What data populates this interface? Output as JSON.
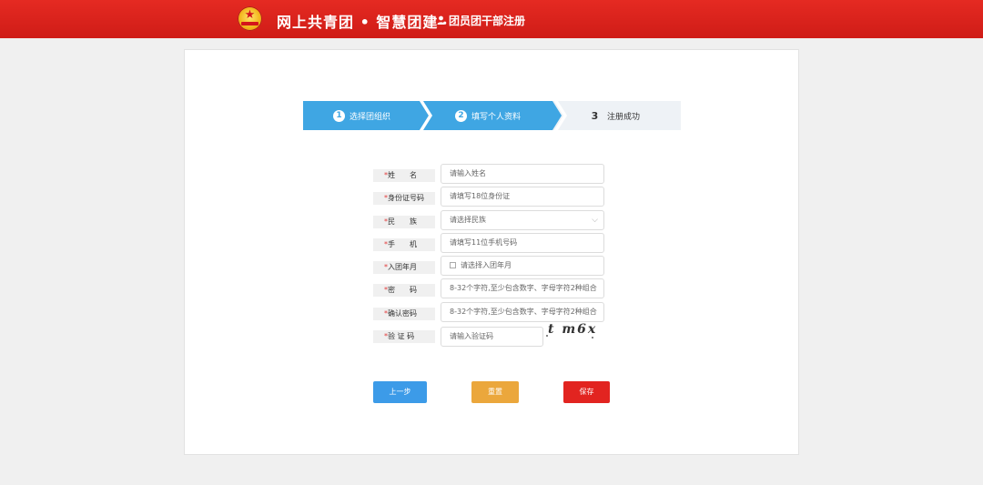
{
  "header": {
    "site_title": "网上共青团 • 智慧团建",
    "register_link": "团员团干部注册",
    "brand_color": "#d8211c"
  },
  "steps": [
    {
      "number": "1",
      "label": "选择团组织",
      "state": "done"
    },
    {
      "number": "2",
      "label": "填写个人资料",
      "state": "active"
    },
    {
      "number": "3",
      "label": "注册成功",
      "state": "pending"
    }
  ],
  "form": {
    "required_mark": "*",
    "fields": [
      {
        "label": "姓　　名",
        "placeholder": "请输入姓名"
      },
      {
        "label": "身份证号码",
        "placeholder": "请填写18位身份证"
      },
      {
        "label": "民　　族",
        "placeholder": "请选择民族"
      },
      {
        "label": "手　　机",
        "placeholder": "请填写11位手机号码"
      },
      {
        "label": "入团年月",
        "placeholder": "请选择入团年月"
      },
      {
        "label": "密　　码",
        "placeholder": "8-32个字符,至少包含数字、字母字符2种组合"
      },
      {
        "label": "确认密码",
        "placeholder": "8-32个字符,至少包含数字、字母字符2种组合"
      },
      {
        "label": "验 证 码",
        "placeholder": "请输入验证码"
      }
    ],
    "captcha_text": "t m6x"
  },
  "buttons": {
    "prev": "上一步",
    "reset": "重置",
    "save": "保存"
  }
}
